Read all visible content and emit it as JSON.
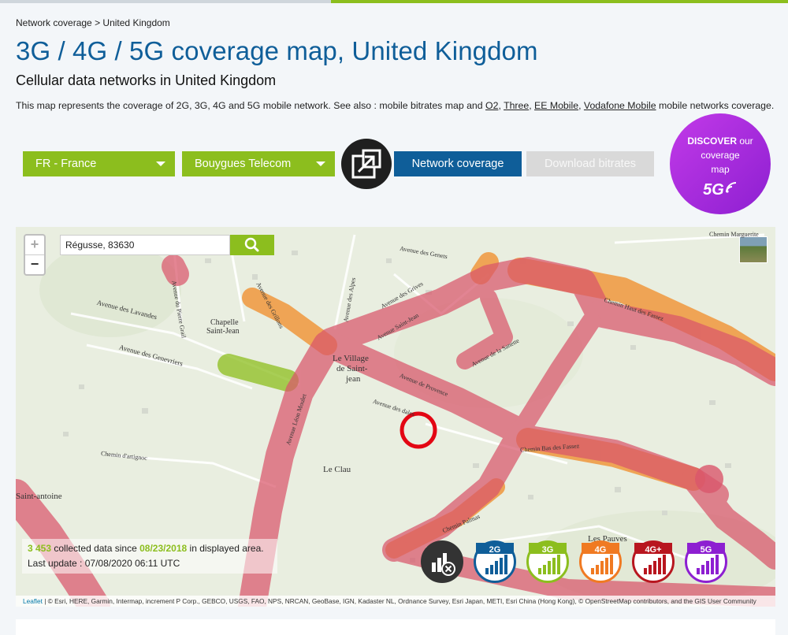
{
  "breadcrumb": {
    "root": "Network coverage",
    "separator": ">",
    "current": "United Kingdom"
  },
  "page": {
    "title": "3G / 4G / 5G coverage map, United Kingdom",
    "subtitle": "Cellular data networks in United Kingdom",
    "intro_prefix": "This map represents the coverage of 2G, 3G, 4G and 5G mobile network. See also : mobile bitrates map and ",
    "links": [
      "O2",
      "Three",
      "EE Mobile",
      "Vodafone Mobile"
    ],
    "intro_suffix": " mobile networks coverage."
  },
  "controls": {
    "country": "FR - France",
    "operator": "Bouygues Telecom",
    "network_coverage": "Network coverage",
    "download_bitrates": "Download bitrates"
  },
  "discover": {
    "line1_bold": "DISCOVER",
    "line1_rest": " our",
    "line2": "coverage",
    "line3": "map",
    "badge": "5G"
  },
  "map": {
    "search_value": "Régusse, 83630",
    "zoom_in": "+",
    "zoom_out": "−",
    "collected_count": "3 453",
    "collected_text": "collected data since",
    "collected_date": "08/23/2018",
    "collected_suffix": "in displayed area.",
    "last_update": "Last update : 07/08/2020 06:11 UTC",
    "attribution_link": "Leaflet",
    "attribution": " | © Esri, HERE, Garmin, Intermap, increment P Corp., GEBCO, USGS, FAO, NPS, NRCAN, GeoBase, IGN, Kadaster NL, Ordnance Survey, Esri Japan, METI, Esri China (Hong Kong), © OpenStreetMap contributors, and the GIS User Community",
    "places": {
      "village": "Le Village",
      "village2": "de Saint-",
      "village3": "jean",
      "chapelle": "Chapelle",
      "chapelle2": "Saint-Jean",
      "clau": "Le Clau",
      "saint_antoine": "Saint-antoine",
      "pauves": "Les Pauves"
    },
    "streets": {
      "lavandes": "Avenue des Lavandes",
      "genevriers": "Avenue des Genevriers",
      "pierre": "Avenue du Pierre Grail",
      "grillons": "Avenue des Grillons",
      "alpes": "Avenue des Alpes",
      "genets": "Avenue des Genets",
      "grives": "Avenue des Grives",
      "saintjean": "Avenue Saint-Jean",
      "sanette": "Avenue de la Sanette",
      "provence": "Avenue de Provence",
      "dales": "Avenue des dales",
      "leonmoule": "Avenue Léon Moulet",
      "artignoc": "Chemin d'artignoc",
      "fassez": "Chemin Haut des Fassez",
      "fassez2": "Chemin Bas des Fassez",
      "marguerite": "Chemin Marguerite",
      "palmas": "Chemin Palmas"
    },
    "network_buttons": [
      {
        "name": "No data",
        "label": "",
        "color": "#333333"
      },
      {
        "name": "2G",
        "label": "2G",
        "color": "#0f5e99"
      },
      {
        "name": "3G",
        "label": "3G",
        "color": "#8cbe1e"
      },
      {
        "name": "4G",
        "label": "4G",
        "color": "#f07a22"
      },
      {
        "name": "4G+",
        "label": "4G+",
        "color": "#b8161f"
      },
      {
        "name": "5G",
        "label": "5G",
        "color": "#8d1fd1"
      }
    ],
    "coverage_colors": {
      "4g": "#f0963c",
      "4g_plus": "#d9566b",
      "3g": "#8cbe1e",
      "marker": "#e30613"
    }
  }
}
